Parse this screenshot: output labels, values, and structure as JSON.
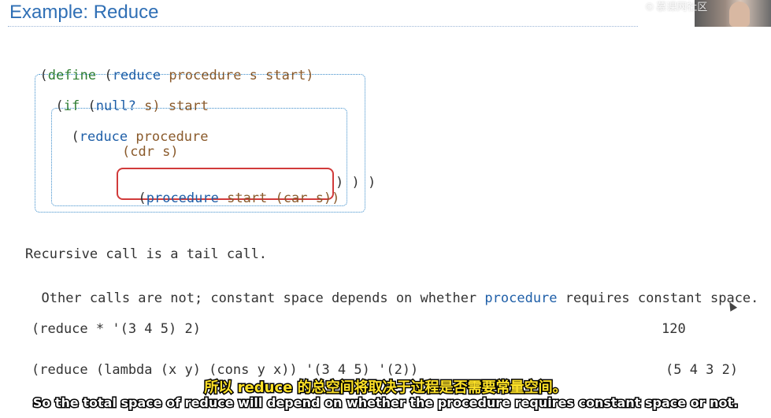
{
  "slide": {
    "title": "Example: Reduce",
    "watermark": "© 慕课网社区"
  },
  "code": {
    "line1": {
      "open": "(",
      "define": "define",
      "space": " ",
      "open2": "(",
      "reduce": "reduce",
      "args": " procedure s start)"
    },
    "line2": {
      "open": "(",
      "if": "if",
      "rest_paren": " (",
      "null": "null?",
      "rest": " s) start"
    },
    "line3": {
      "open": "(",
      "reduce": "reduce",
      "rest": " procedure"
    },
    "line4": {
      "text": "(cdr s)"
    },
    "line5": {
      "open": "(",
      "procedure": "procedure",
      "start": " start ",
      "car": "(car s))"
    },
    "closing": ") ) )"
  },
  "prose": {
    "line1": "Recursive call is a tail call.",
    "line2_prefix": "Other calls are not; constant space depends on whether ",
    "line2_highlight": "procedure",
    "line2_suffix": " requires constant space."
  },
  "examples": [
    {
      "expr": "(reduce * '(3 4 5) 2)",
      "result": "120"
    },
    {
      "expr": "(reduce (lambda (x y) (cons y x)) '(3 4 5) '(2))",
      "result": "(5 4 3 2)"
    }
  ],
  "subtitles": {
    "chinese": "所以 reduce 的总空间将取决于过程是否需要常量空间。",
    "english": "So the total space of reduce will depend on whether the procedure requires constant space or not."
  }
}
